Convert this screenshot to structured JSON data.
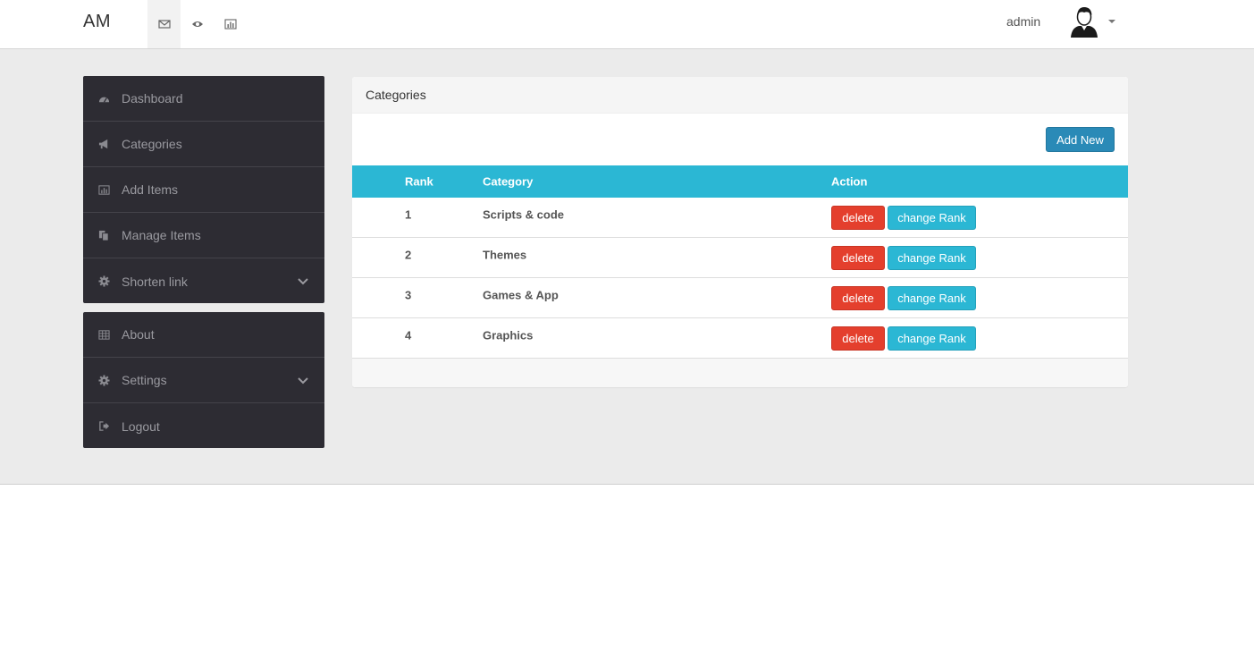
{
  "navbar": {
    "brand": "AM",
    "icons": [
      "envelope-icon",
      "eye-icon",
      "bar-chart-icon"
    ],
    "user": "admin"
  },
  "sidebar": {
    "group1": [
      {
        "label": "Dashboard",
        "icon": "dashboard-icon"
      },
      {
        "label": "Categories",
        "icon": "bullhorn-icon"
      },
      {
        "label": "Add Items",
        "icon": "bar-chart-icon"
      },
      {
        "label": "Manage Items",
        "icon": "copy-icon"
      },
      {
        "label": "Shorten link",
        "icon": "gear-icon",
        "expandable": true
      }
    ],
    "group2": [
      {
        "label": "About",
        "icon": "table-icon"
      },
      {
        "label": "Settings",
        "icon": "gear-icon",
        "expandable": true
      },
      {
        "label": "Logout",
        "icon": "sign-out-icon"
      }
    ]
  },
  "panel": {
    "title": "Categories",
    "add_label": "Add New",
    "columns": {
      "rank": "Rank",
      "category": "Category",
      "action": "Action"
    },
    "rows": [
      {
        "rank": "1",
        "category": "Scripts & code"
      },
      {
        "rank": "2",
        "category": "Themes"
      },
      {
        "rank": "3",
        "category": "Games & App"
      },
      {
        "rank": "4",
        "category": "Graphics"
      }
    ],
    "delete_label": "delete",
    "change_rank_label": "change Rank"
  },
  "colors": {
    "sidebar_bg": "#2d2c33",
    "table_header": "#2bb7d4",
    "delete_btn": "#e43f2d",
    "add_btn": "#2a8ab7"
  }
}
